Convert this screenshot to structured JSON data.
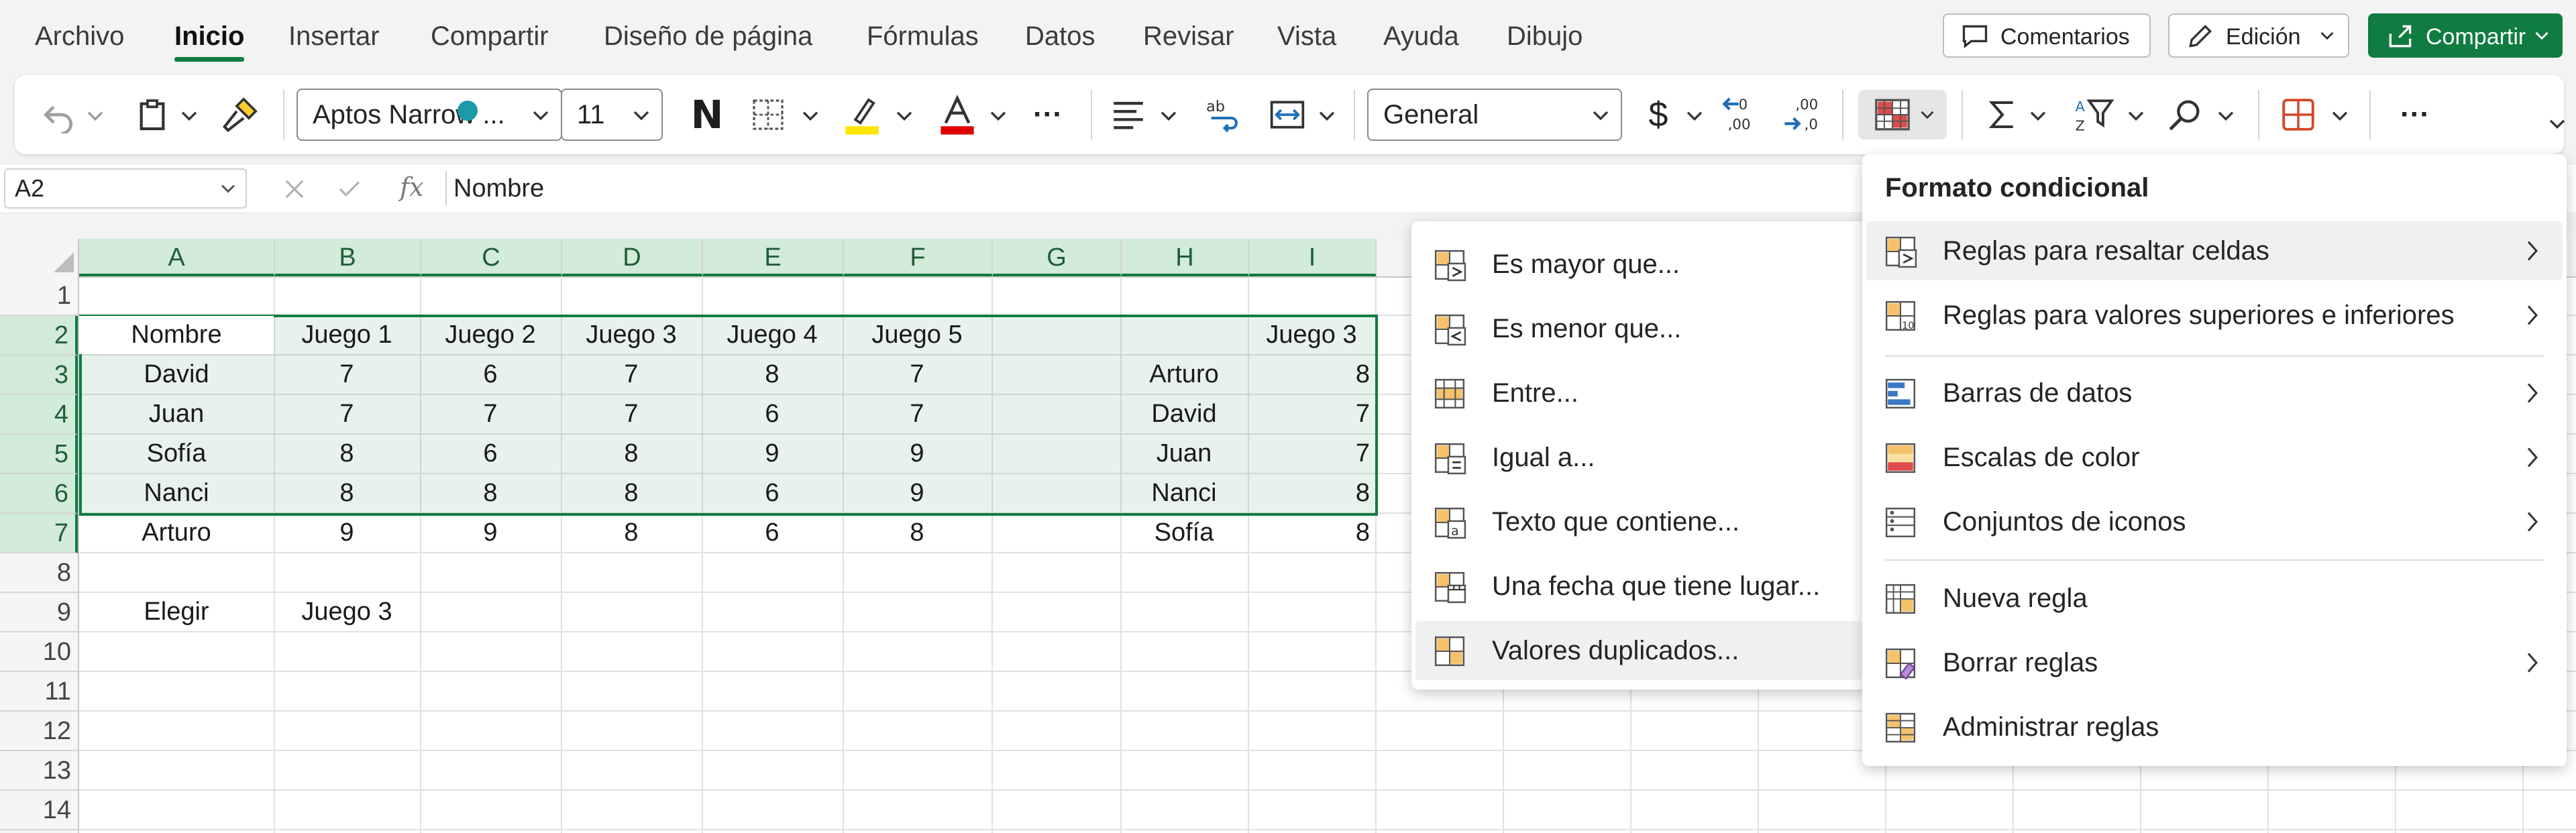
{
  "menu": {
    "tabs": [
      "Archivo",
      "Inicio",
      "Insertar",
      "Compartir",
      "Diseño de página",
      "Fórmulas",
      "Datos",
      "Revisar",
      "Vista",
      "Ayuda",
      "Dibujo"
    ],
    "active_tab": "Inicio",
    "comments_label": "Comentarios",
    "edit_label": "Edición",
    "share_label": "Compartir"
  },
  "ribbon": {
    "font_name": "Aptos Narrow ...",
    "font_size": "11",
    "bold_label": "N",
    "more_label": "···",
    "number_format": "General",
    "currency_symbol": "$",
    "colors": {
      "highlight": "#ffe600",
      "font_color": "#e00000"
    }
  },
  "formula_bar": {
    "name_box": "A2",
    "fx_label": "fx",
    "formula": "Nombre"
  },
  "sheet": {
    "columns": [
      "A",
      "B",
      "C",
      "D",
      "E",
      "F",
      "G",
      "H",
      "I"
    ],
    "rows": [
      "1",
      "2",
      "3",
      "4",
      "5",
      "6",
      "7",
      "8",
      "9",
      "10",
      "11",
      "12",
      "13",
      "14"
    ],
    "main_table": {
      "headers": [
        "Nombre",
        "Juego 1",
        "Juego 2",
        "Juego 3",
        "Juego 4",
        "Juego 5"
      ],
      "rows": [
        [
          "David",
          "7",
          "6",
          "7",
          "8",
          "7"
        ],
        [
          "Juan",
          "7",
          "7",
          "7",
          "6",
          "7"
        ],
        [
          "Sofía",
          "8",
          "6",
          "8",
          "9",
          "9"
        ],
        [
          "Nanci",
          "8",
          "8",
          "8",
          "6",
          "9"
        ],
        [
          "Arturo",
          "9",
          "9",
          "8",
          "6",
          "8"
        ]
      ]
    },
    "side_table": {
      "header": "Juego 3",
      "rows": [
        [
          "Arturo",
          "8"
        ],
        [
          "David",
          "7"
        ],
        [
          "Juan",
          "7"
        ],
        [
          "Nanci",
          "8"
        ],
        [
          "Sofía",
          "8"
        ]
      ]
    },
    "choose_label": "Elegir",
    "choose_value": "Juego 3"
  },
  "conditional_format_menu": {
    "title": "Formato condicional",
    "items": [
      {
        "label": "Reglas para resaltar celdas",
        "icon": "highlight-cells-icon",
        "submenu": true
      },
      {
        "label": "Reglas para valores superiores e inferiores",
        "icon": "top-bottom-icon",
        "submenu": true
      },
      {
        "label": "Barras de datos",
        "icon": "data-bars-icon",
        "submenu": true
      },
      {
        "label": "Escalas de color",
        "icon": "color-scales-icon",
        "submenu": true
      },
      {
        "label": "Conjuntos de iconos",
        "icon": "icon-sets-icon",
        "submenu": true
      },
      {
        "label": "Nueva regla",
        "icon": "new-rule-icon",
        "submenu": false
      },
      {
        "label": "Borrar reglas",
        "icon": "clear-rules-icon",
        "submenu": true
      },
      {
        "label": "Administrar reglas",
        "icon": "manage-rules-icon",
        "submenu": false
      }
    ]
  },
  "highlight_rules_submenu": {
    "items": [
      {
        "label": "Es mayor que...",
        "icon": "greater-than-icon"
      },
      {
        "label": "Es menor que...",
        "icon": "less-than-icon"
      },
      {
        "label": "Entre...",
        "icon": "between-icon"
      },
      {
        "label": "Igual a...",
        "icon": "equal-to-icon"
      },
      {
        "label": "Texto que contiene...",
        "icon": "text-contains-icon"
      },
      {
        "label": "Una fecha que tiene lugar...",
        "icon": "date-occurring-icon"
      },
      {
        "label": "Valores duplicados...",
        "icon": "duplicate-values-icon"
      }
    ]
  }
}
